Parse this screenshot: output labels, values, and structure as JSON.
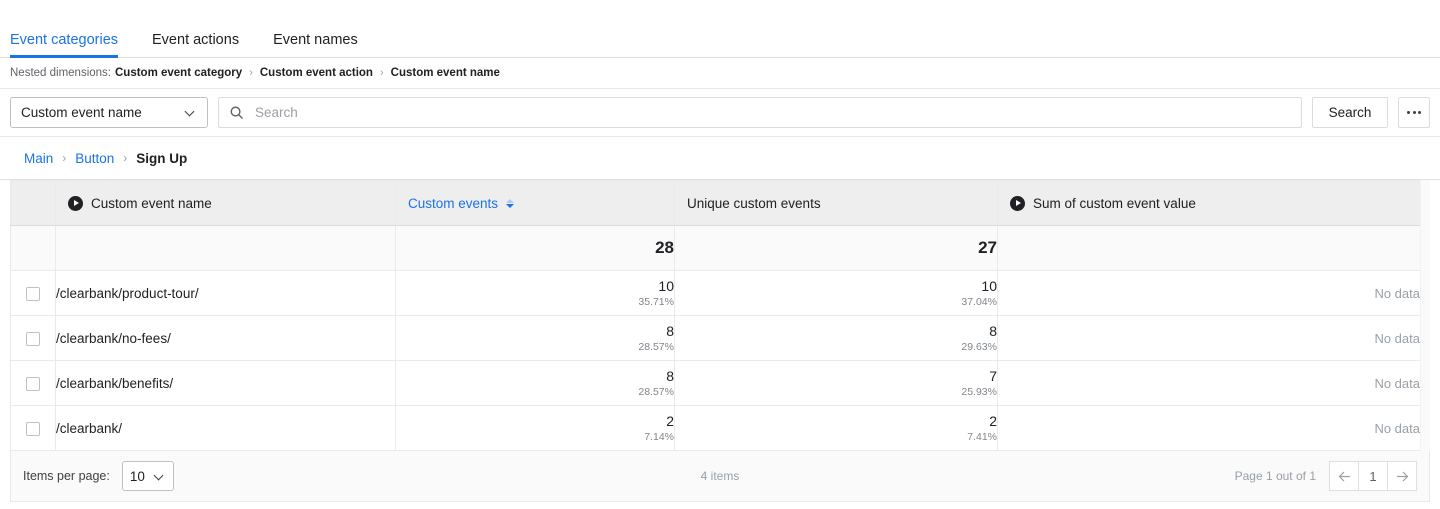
{
  "tabs": [
    {
      "label": "Event categories",
      "active": true
    },
    {
      "label": "Event actions",
      "active": false
    },
    {
      "label": "Event names",
      "active": false
    }
  ],
  "nested_dimensions": {
    "label": "Nested dimensions:",
    "items": [
      "Custom event category",
      "Custom event action",
      "Custom event name"
    ],
    "separator": "›"
  },
  "toolbar": {
    "dimension_select": {
      "value": "Custom event name",
      "icon": "chevron-down-icon"
    },
    "search": {
      "value": "",
      "placeholder": "Search",
      "icon": "search-icon"
    },
    "search_button_label": "Search",
    "more_button_label": "•••"
  },
  "breadcrumb": {
    "items": [
      {
        "label": "Main",
        "current": false
      },
      {
        "label": "Button",
        "current": false
      },
      {
        "label": "Sign Up",
        "current": true
      }
    ],
    "separator": "›"
  },
  "table": {
    "columns": [
      {
        "key": "select",
        "label": "",
        "icon": null,
        "sortable": false,
        "align": "center"
      },
      {
        "key": "name",
        "label": "Custom event name",
        "icon": "play-circle-icon",
        "sortable": false,
        "align": "left"
      },
      {
        "key": "custom_events",
        "label": "Custom events",
        "icon": null,
        "sortable": true,
        "sort_state": "desc",
        "align": "left"
      },
      {
        "key": "unique_custom_events",
        "label": "Unique custom events",
        "icon": null,
        "sortable": false,
        "align": "left"
      },
      {
        "key": "sum_value",
        "label": "Sum of custom event value",
        "icon": "play-circle-icon",
        "sortable": false,
        "align": "left"
      }
    ],
    "totals": {
      "custom_events": "28",
      "unique_custom_events": "27",
      "sum_value": ""
    },
    "rows": [
      {
        "name": "/clearbank/product-tour/",
        "custom_events": "10",
        "custom_events_pct": "35.71%",
        "unique_custom_events": "10",
        "unique_custom_events_pct": "37.04%",
        "sum_value": "No data",
        "checked": false
      },
      {
        "name": "/clearbank/no-fees/",
        "custom_events": "8",
        "custom_events_pct": "28.57%",
        "unique_custom_events": "8",
        "unique_custom_events_pct": "29.63%",
        "sum_value": "No data",
        "checked": false
      },
      {
        "name": "/clearbank/benefits/",
        "custom_events": "8",
        "custom_events_pct": "28.57%",
        "unique_custom_events": "7",
        "unique_custom_events_pct": "25.93%",
        "sum_value": "No data",
        "checked": false
      },
      {
        "name": "/clearbank/",
        "custom_events": "2",
        "custom_events_pct": "7.14%",
        "unique_custom_events": "2",
        "unique_custom_events_pct": "7.41%",
        "sum_value": "No data",
        "checked": false
      }
    ]
  },
  "footer": {
    "items_per_page_label": "Items per page:",
    "items_per_page_value": "10",
    "items_count": "4 items",
    "page_label": "Page 1 out of 1",
    "current_page": "1",
    "prev_icon": "arrow-left-icon",
    "next_icon": "arrow-right-icon"
  },
  "colors": {
    "accent": "#1a73e8",
    "text": "#202124",
    "muted": "#9aa0a6",
    "header_bg": "#eeeeee"
  }
}
